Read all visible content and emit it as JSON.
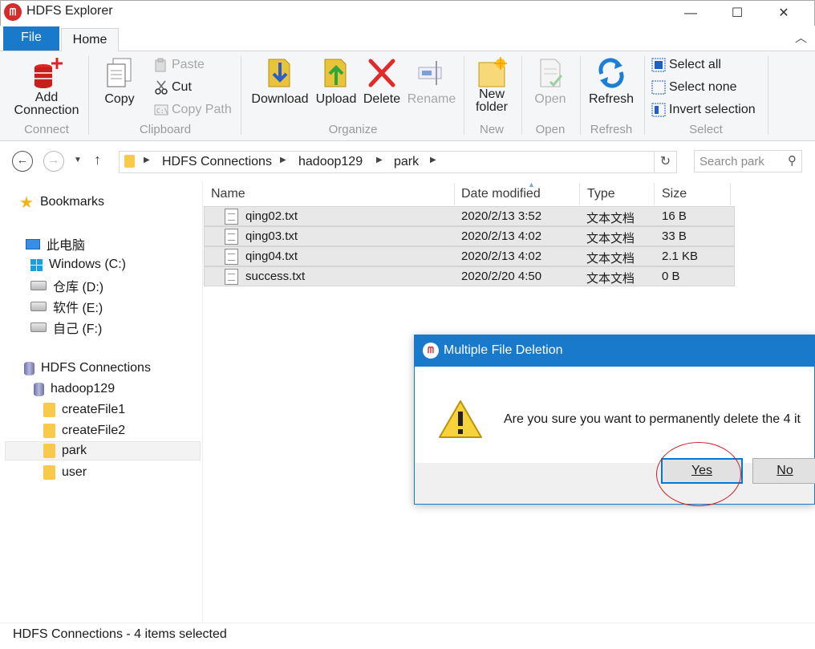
{
  "window": {
    "title": "HDFS Explorer",
    "minimize": "—",
    "maximize": "☐",
    "close": "✕"
  },
  "ribbon_tabs": {
    "file": "File",
    "home": "Home"
  },
  "ribbon": {
    "connect": {
      "add_connection": "Add\nConnection",
      "group": "Connect"
    },
    "clipboard": {
      "copy": "Copy",
      "paste": "Paste",
      "cut": "Cut",
      "copy_path": "Copy Path",
      "group": "Clipboard"
    },
    "organize": {
      "download": "Download",
      "upload": "Upload",
      "delete": "Delete",
      "rename": "Rename",
      "group": "Organize"
    },
    "new": {
      "new_folder": "New\nfolder",
      "group": "New"
    },
    "open": {
      "open": "Open",
      "group": "Open"
    },
    "refresh": {
      "refresh": "Refresh",
      "group": "Refresh"
    },
    "select": {
      "select_all": "Select all",
      "select_none": "Select none",
      "invert": "Invert selection",
      "group": "Select"
    }
  },
  "address": {
    "crumbs": [
      "HDFS Connections",
      "hadoop129",
      "park"
    ],
    "search_placeholder": "Search park"
  },
  "nav": {
    "bookmarks": "Bookmarks",
    "this_pc": "此电脑",
    "drives": [
      "Windows (C:)",
      "仓库 (D:)",
      "软件 (E:)",
      "自己 (F:)"
    ],
    "hdfs_connections": "HDFS Connections",
    "host": "hadoop129",
    "folders": [
      "createFile1",
      "createFile2",
      "park",
      "user"
    ],
    "selected_folder": "park"
  },
  "file_list": {
    "columns": [
      "Name",
      "Date modified",
      "Type",
      "Size"
    ],
    "rows": [
      {
        "name": "qing02.txt",
        "date": "2020/2/13 3:52",
        "type": "文本文档",
        "size": "16 B"
      },
      {
        "name": "qing03.txt",
        "date": "2020/2/13 4:02",
        "type": "文本文档",
        "size": "33 B"
      },
      {
        "name": "qing04.txt",
        "date": "2020/2/13 4:02",
        "type": "文本文档",
        "size": "2.1 KB"
      },
      {
        "name": "success.txt",
        "date": "2020/2/20 4:50",
        "type": "文本文档",
        "size": "0 B"
      }
    ]
  },
  "status": "HDFS Connections - 4 items selected",
  "dialog": {
    "title": "Multiple File Deletion",
    "message": "Are you sure you want to permanently delete the 4 it",
    "yes": "Yes",
    "no": "No"
  },
  "colors": {
    "accent": "#1979ca",
    "brand_red": "#d42b2b",
    "highlight_circle": "#d0202a"
  }
}
